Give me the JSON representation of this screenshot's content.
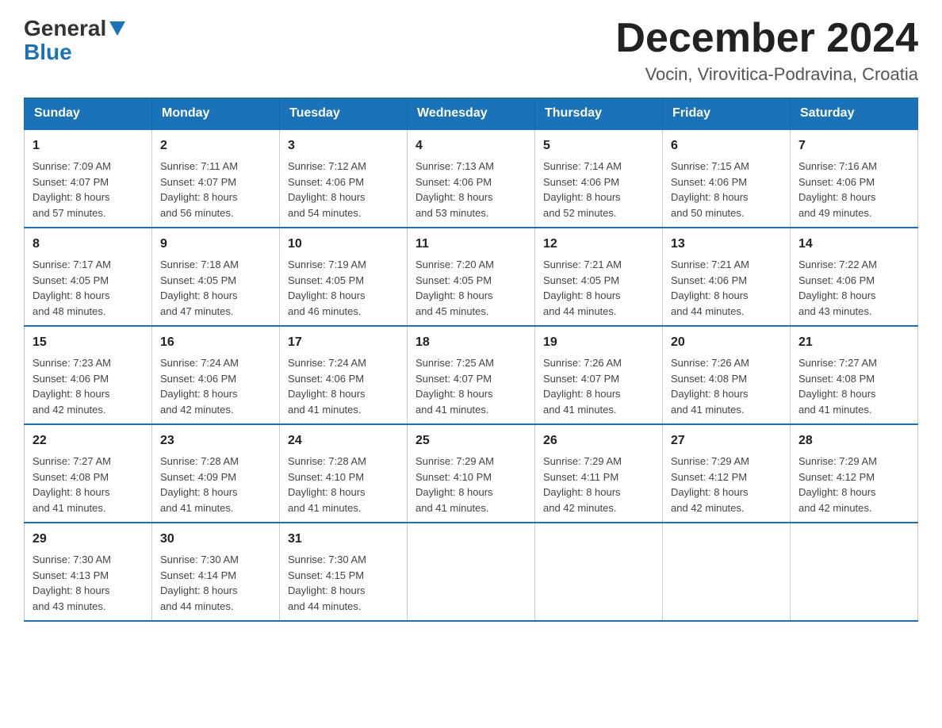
{
  "header": {
    "month_title": "December 2024",
    "location": "Vocin, Virovitica-Podravina, Croatia"
  },
  "days_of_week": [
    "Sunday",
    "Monday",
    "Tuesday",
    "Wednesday",
    "Thursday",
    "Friday",
    "Saturday"
  ],
  "weeks": [
    [
      {
        "day": "1",
        "sunrise": "7:09 AM",
        "sunset": "4:07 PM",
        "daylight": "8 hours and 57 minutes."
      },
      {
        "day": "2",
        "sunrise": "7:11 AM",
        "sunset": "4:07 PM",
        "daylight": "8 hours and 56 minutes."
      },
      {
        "day": "3",
        "sunrise": "7:12 AM",
        "sunset": "4:06 PM",
        "daylight": "8 hours and 54 minutes."
      },
      {
        "day": "4",
        "sunrise": "7:13 AM",
        "sunset": "4:06 PM",
        "daylight": "8 hours and 53 minutes."
      },
      {
        "day": "5",
        "sunrise": "7:14 AM",
        "sunset": "4:06 PM",
        "daylight": "8 hours and 52 minutes."
      },
      {
        "day": "6",
        "sunrise": "7:15 AM",
        "sunset": "4:06 PM",
        "daylight": "8 hours and 50 minutes."
      },
      {
        "day": "7",
        "sunrise": "7:16 AM",
        "sunset": "4:06 PM",
        "daylight": "8 hours and 49 minutes."
      }
    ],
    [
      {
        "day": "8",
        "sunrise": "7:17 AM",
        "sunset": "4:05 PM",
        "daylight": "8 hours and 48 minutes."
      },
      {
        "day": "9",
        "sunrise": "7:18 AM",
        "sunset": "4:05 PM",
        "daylight": "8 hours and 47 minutes."
      },
      {
        "day": "10",
        "sunrise": "7:19 AM",
        "sunset": "4:05 PM",
        "daylight": "8 hours and 46 minutes."
      },
      {
        "day": "11",
        "sunrise": "7:20 AM",
        "sunset": "4:05 PM",
        "daylight": "8 hours and 45 minutes."
      },
      {
        "day": "12",
        "sunrise": "7:21 AM",
        "sunset": "4:05 PM",
        "daylight": "8 hours and 44 minutes."
      },
      {
        "day": "13",
        "sunrise": "7:21 AM",
        "sunset": "4:06 PM",
        "daylight": "8 hours and 44 minutes."
      },
      {
        "day": "14",
        "sunrise": "7:22 AM",
        "sunset": "4:06 PM",
        "daylight": "8 hours and 43 minutes."
      }
    ],
    [
      {
        "day": "15",
        "sunrise": "7:23 AM",
        "sunset": "4:06 PM",
        "daylight": "8 hours and 42 minutes."
      },
      {
        "day": "16",
        "sunrise": "7:24 AM",
        "sunset": "4:06 PM",
        "daylight": "8 hours and 42 minutes."
      },
      {
        "day": "17",
        "sunrise": "7:24 AM",
        "sunset": "4:06 PM",
        "daylight": "8 hours and 41 minutes."
      },
      {
        "day": "18",
        "sunrise": "7:25 AM",
        "sunset": "4:07 PM",
        "daylight": "8 hours and 41 minutes."
      },
      {
        "day": "19",
        "sunrise": "7:26 AM",
        "sunset": "4:07 PM",
        "daylight": "8 hours and 41 minutes."
      },
      {
        "day": "20",
        "sunrise": "7:26 AM",
        "sunset": "4:08 PM",
        "daylight": "8 hours and 41 minutes."
      },
      {
        "day": "21",
        "sunrise": "7:27 AM",
        "sunset": "4:08 PM",
        "daylight": "8 hours and 41 minutes."
      }
    ],
    [
      {
        "day": "22",
        "sunrise": "7:27 AM",
        "sunset": "4:08 PM",
        "daylight": "8 hours and 41 minutes."
      },
      {
        "day": "23",
        "sunrise": "7:28 AM",
        "sunset": "4:09 PM",
        "daylight": "8 hours and 41 minutes."
      },
      {
        "day": "24",
        "sunrise": "7:28 AM",
        "sunset": "4:10 PM",
        "daylight": "8 hours and 41 minutes."
      },
      {
        "day": "25",
        "sunrise": "7:29 AM",
        "sunset": "4:10 PM",
        "daylight": "8 hours and 41 minutes."
      },
      {
        "day": "26",
        "sunrise": "7:29 AM",
        "sunset": "4:11 PM",
        "daylight": "8 hours and 42 minutes."
      },
      {
        "day": "27",
        "sunrise": "7:29 AM",
        "sunset": "4:12 PM",
        "daylight": "8 hours and 42 minutes."
      },
      {
        "day": "28",
        "sunrise": "7:29 AM",
        "sunset": "4:12 PM",
        "daylight": "8 hours and 42 minutes."
      }
    ],
    [
      {
        "day": "29",
        "sunrise": "7:30 AM",
        "sunset": "4:13 PM",
        "daylight": "8 hours and 43 minutes."
      },
      {
        "day": "30",
        "sunrise": "7:30 AM",
        "sunset": "4:14 PM",
        "daylight": "8 hours and 44 minutes."
      },
      {
        "day": "31",
        "sunrise": "7:30 AM",
        "sunset": "4:15 PM",
        "daylight": "8 hours and 44 minutes."
      },
      null,
      null,
      null,
      null
    ]
  ],
  "labels": {
    "sunrise": "Sunrise:",
    "sunset": "Sunset:",
    "daylight": "Daylight:"
  }
}
